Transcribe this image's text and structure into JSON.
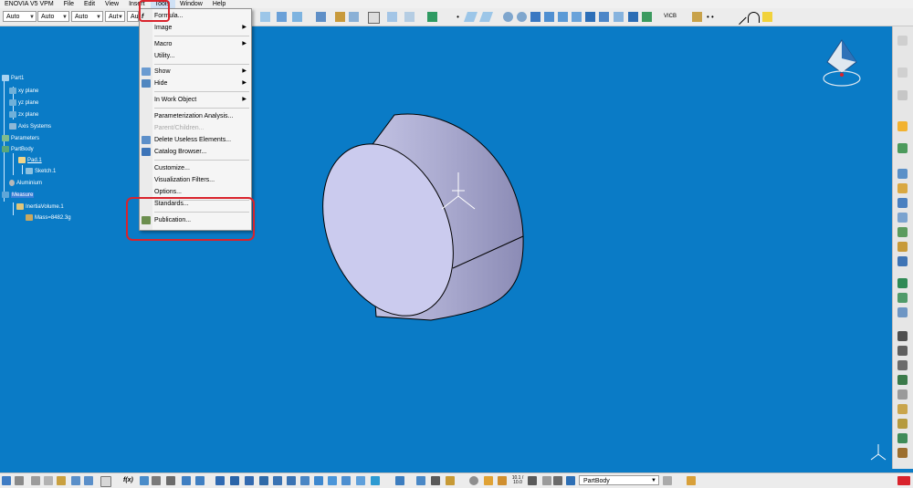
{
  "menubar": {
    "app_title": "ENOVIA V5 VPM",
    "items": [
      "File",
      "Edit",
      "View",
      "Insert",
      "Tools",
      "Window",
      "Help"
    ]
  },
  "toolbar": {
    "combos": [
      "Auto",
      "Auto",
      "Auto",
      "Aut",
      "Au"
    ]
  },
  "tools_menu": {
    "items": [
      {
        "label": "Formula...",
        "submenu": false,
        "disabled": false,
        "icon": "formula-icon"
      },
      {
        "label": "Image",
        "submenu": true,
        "disabled": false
      },
      {
        "label": "Macro",
        "submenu": true,
        "disabled": false
      },
      {
        "label": "Utility...",
        "submenu": false,
        "disabled": false
      },
      {
        "label": "Show",
        "submenu": true,
        "disabled": false,
        "icon": "show-icon"
      },
      {
        "label": "Hide",
        "submenu": true,
        "disabled": false,
        "icon": "hide-icon"
      },
      {
        "label": "In Work Object",
        "submenu": true,
        "disabled": false
      },
      {
        "label": "Parameterization Analysis...",
        "submenu": false,
        "disabled": false
      },
      {
        "label": "Parent/Children...",
        "submenu": false,
        "disabled": true
      },
      {
        "label": "Delete Useless Elements...",
        "submenu": false,
        "disabled": false,
        "icon": "delete-useless-icon"
      },
      {
        "label": "Catalog Browser...",
        "submenu": false,
        "disabled": false,
        "icon": "catalog-icon"
      },
      {
        "label": "Customize...",
        "submenu": false,
        "disabled": false
      },
      {
        "label": "Visualization Filters...",
        "submenu": false,
        "disabled": false
      },
      {
        "label": "Options...",
        "submenu": false,
        "disabled": false
      },
      {
        "label": "Standards...",
        "submenu": false,
        "disabled": false
      },
      {
        "label": "Publication...",
        "submenu": false,
        "disabled": false,
        "icon": "publication-icon"
      }
    ]
  },
  "tree": {
    "root": "Part1",
    "nodes": [
      "xy plane",
      "yz plane",
      "zx plane",
      "Axis Systems",
      "Parameters",
      "PartBody",
      "Pad.1",
      "Sketch.1",
      "Aluminium",
      "Measure",
      "InertiaVolume.1",
      "Mass=8482.3g"
    ]
  },
  "bottombar": {
    "current_body": "PartBody",
    "f_of_x": "f(x)",
    "ratio": "10.1 / 10.0"
  },
  "colors": {
    "background": "#0a7bc6",
    "highlight_box": "#d9232c",
    "solid_face": "#c9c9ea",
    "solid_side": "#9a9ab8"
  }
}
